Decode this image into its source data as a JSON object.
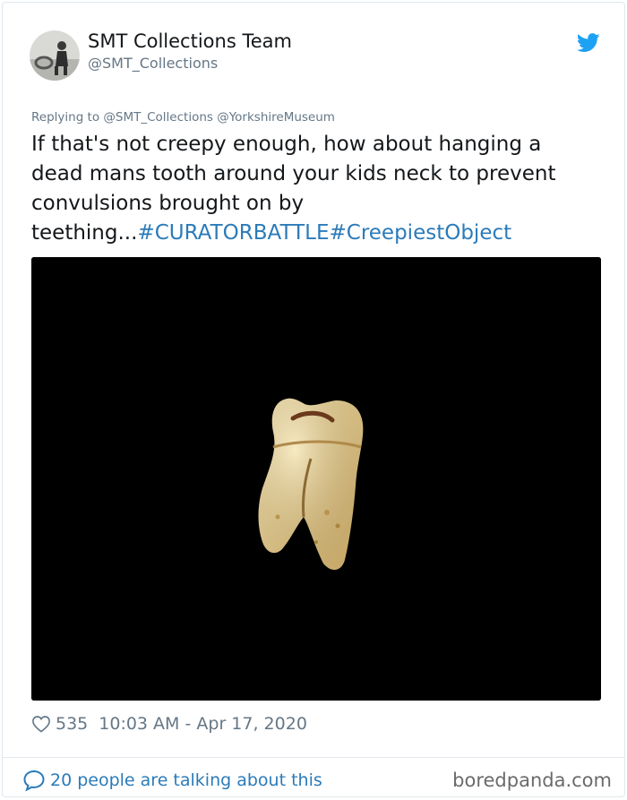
{
  "author": {
    "name": "SMT Collections Team",
    "handle": "@SMT_Collections"
  },
  "replying": {
    "text": "Replying to @SMT_Collections @YorkshireMuseum"
  },
  "tweet": {
    "line1": "If that's not creepy enough, how about hanging a",
    "line2": "dead mans tooth around your kids neck to prevent",
    "line3": "convulsions brought on by",
    "line4_text": "teething...",
    "hashtag1": "#CURATORBATTLE",
    "hashtag2": "#CreepiestObject"
  },
  "stats": {
    "likes": "535",
    "timestamp": "10:03 AM - Apr 17, 2020"
  },
  "conversation": {
    "label": "20 people are talking about this"
  },
  "watermark": "boredpanda.com",
  "colors": {
    "link": "#2b7bb9",
    "secondary_text": "#657786",
    "twitter_blue": "#1da1f2"
  },
  "icons": {
    "brand": "twitter-bird-icon",
    "like": "heart-icon",
    "reply": "speech-bubble-icon"
  }
}
